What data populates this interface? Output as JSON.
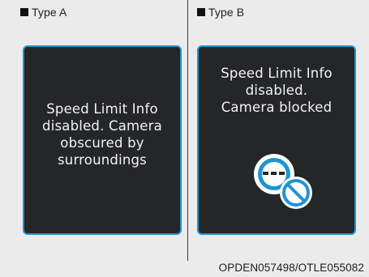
{
  "type_a": {
    "label": "Type A",
    "message": "Speed Limit Info\ndisabled. Camera\nobscured by\nsurroundings"
  },
  "type_b": {
    "label": "Type B",
    "message": "Speed Limit Info\ndisabled.\nCamera blocked",
    "icon": "camera-blocked-icon"
  },
  "caption": "OPDEN057498/OTLE055082",
  "colors": {
    "panel_bg": "#252628",
    "panel_border": "#1f93d2",
    "panel_text": "#f2f2f2",
    "page_bg": "#ebebeb"
  }
}
